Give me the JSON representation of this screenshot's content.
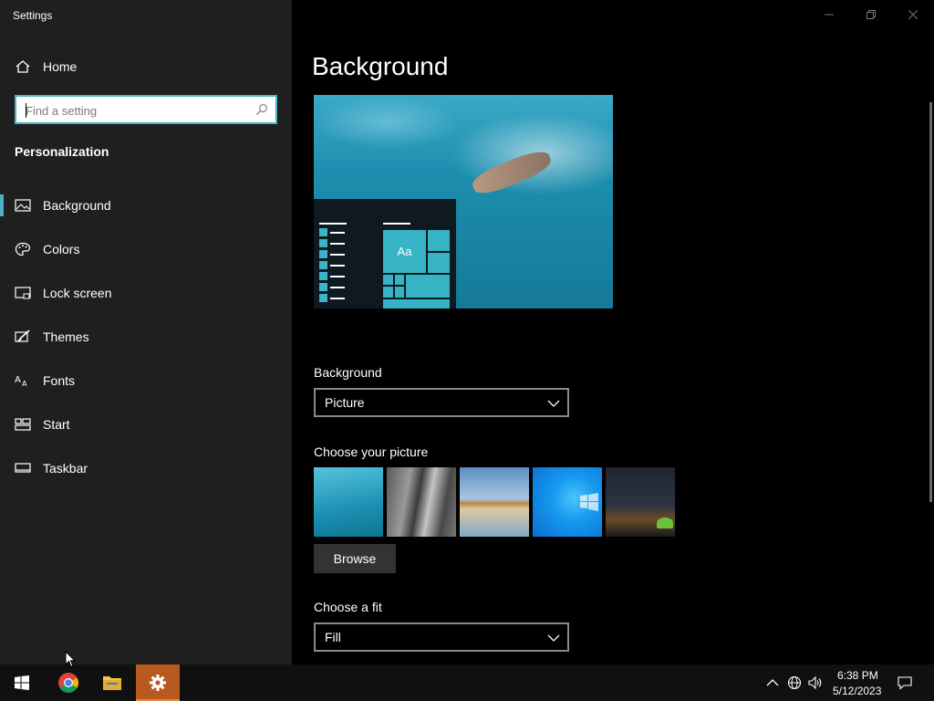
{
  "window": {
    "title": "Settings"
  },
  "sidebar": {
    "home_label": "Home",
    "search_placeholder": "Find a setting",
    "section_title": "Personalization",
    "items": [
      {
        "label": "Background",
        "icon": "picture-icon",
        "selected": true
      },
      {
        "label": "Colors",
        "icon": "palette-icon",
        "selected": false
      },
      {
        "label": "Lock screen",
        "icon": "lock-screen-icon",
        "selected": false
      },
      {
        "label": "Themes",
        "icon": "brush-icon",
        "selected": false
      },
      {
        "label": "Fonts",
        "icon": "fonts-icon",
        "selected": false
      },
      {
        "label": "Start",
        "icon": "start-icon",
        "selected": false
      },
      {
        "label": "Taskbar",
        "icon": "taskbar-icon",
        "selected": false
      }
    ]
  },
  "main": {
    "title": "Background",
    "preview_tile_text": "Aa",
    "background_label": "Background",
    "background_value": "Picture",
    "choose_picture_label": "Choose your picture",
    "browse_label": "Browse",
    "fit_label": "Choose a fit",
    "fit_value": "Fill"
  },
  "taskbar": {
    "apps": [
      "windows-start",
      "chrome",
      "file-explorer",
      "settings"
    ],
    "time": "6:38 PM",
    "date": "5/12/2023"
  },
  "colors": {
    "accent": "#4ab3c6",
    "sidebar_bg": "#1f1f1f",
    "active_taskbar": "#b85a1f"
  }
}
